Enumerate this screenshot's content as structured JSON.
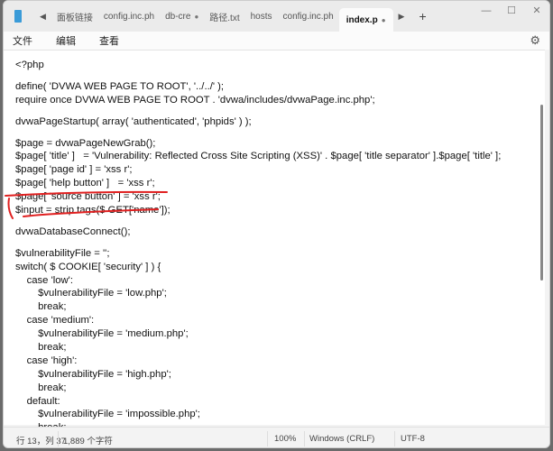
{
  "tabs": [
    {
      "label": "面板链接",
      "dot": false
    },
    {
      "label": "config.inc.ph",
      "dot": false
    },
    {
      "label": "db-cre",
      "dot": true
    },
    {
      "label": "路径.txt",
      "dot": false
    },
    {
      "label": "hosts",
      "dot": false
    },
    {
      "label": "config.inc.ph",
      "dot": false
    },
    {
      "label": "index.p",
      "dot": true,
      "active": true
    }
  ],
  "menu": {
    "file": "文件",
    "edit": "编辑",
    "view": "查看"
  },
  "code": [
    "<?php",
    "",
    "define( 'DVWA WEB PAGE TO ROOT', '../../' );",
    "require once DVWA WEB PAGE TO ROOT . 'dvwa/includes/dvwaPage.inc.php';",
    "",
    "dvwaPageStartup( array( 'authenticated', 'phpids' ) );",
    "",
    "$page = dvwaPageNewGrab();",
    "$page[ 'title' ]   = 'Vulnerability: Reflected Cross Site Scripting (XSS)' . $page[ 'title separator' ].$page[ 'title' ];",
    "$page[ 'page id' ] = 'xss r';",
    "$page[ 'help button' ]   = 'xss r';",
    "$page[ 'source button' ] = 'xss r';",
    "$input = strip tags($ GET['name']);",
    "",
    "dvwaDatabaseConnect();",
    "",
    "$vulnerabilityFile = '';",
    "switch( $ COOKIE[ 'security' ] ) {",
    "\tcase 'low':",
    "\t\t$vulnerabilityFile = 'low.php';",
    "\t\tbreak;",
    "\tcase 'medium':",
    "\t\t$vulnerabilityFile = 'medium.php';",
    "\t\tbreak;",
    "\tcase 'high':",
    "\t\t$vulnerabilityFile = 'high.php';",
    "\t\tbreak;",
    "\tdefault:",
    "\t\t$vulnerabilityFile = 'impossible.php';",
    "\t\tbreak;",
    "}"
  ],
  "status": {
    "position": "行 13，列 37",
    "chars": "1,889 个字符",
    "zoom": "100%",
    "line_ending": "Windows (CRLF)",
    "encoding": "UTF-8"
  },
  "annotation_color": "#e02020"
}
